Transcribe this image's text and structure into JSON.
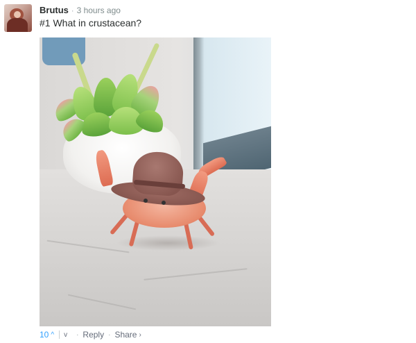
{
  "comment": {
    "author": "Brutus",
    "separator": "·",
    "timestamp": "3 hours ago",
    "message": "#1 What in crustacean?"
  },
  "actions": {
    "vote_count": "10",
    "upvote_icon": "^",
    "downvote_icon": "v",
    "reply_label": "Reply",
    "share_label": "Share",
    "share_arrow": "›",
    "bullet": "·"
  },
  "colors": {
    "accent": "#2e9fff",
    "text": "#2a2e2e",
    "muted": "#7f8c8d"
  }
}
